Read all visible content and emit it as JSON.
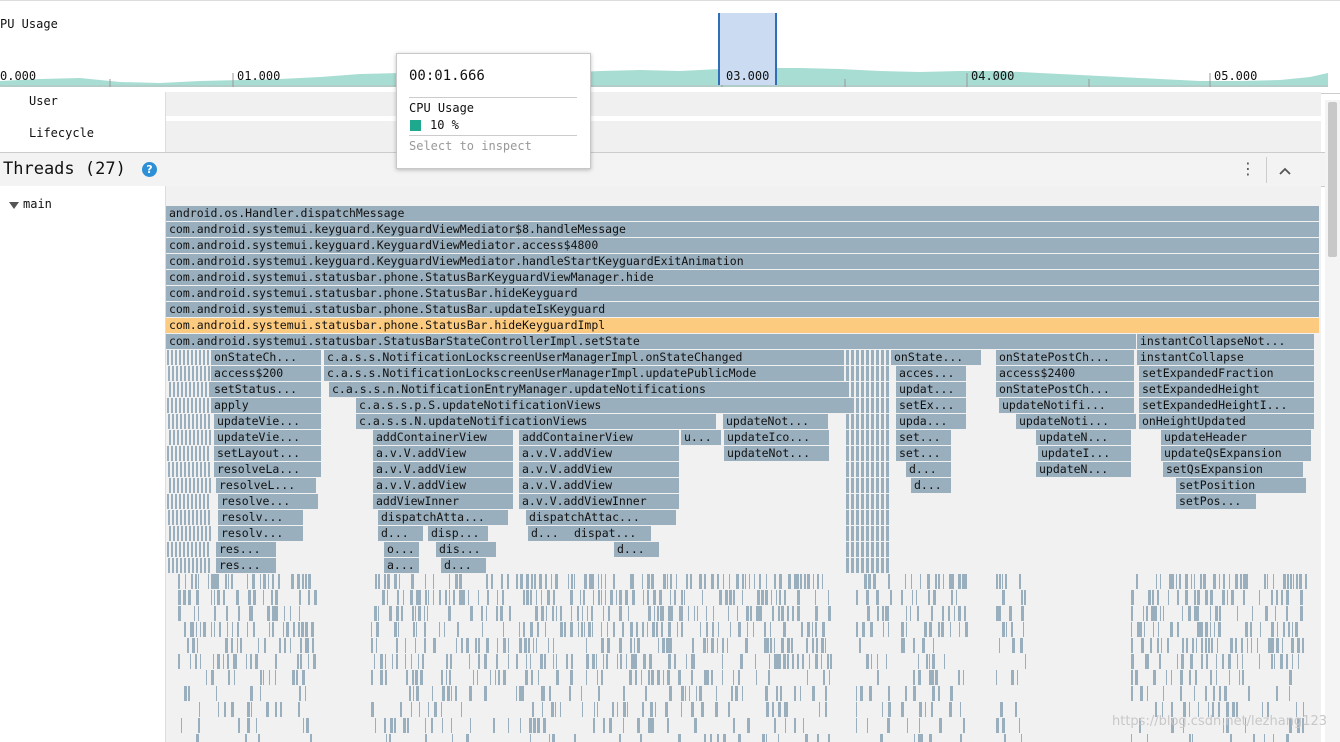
{
  "cpu": {
    "title": "PU Usage",
    "ticks": [
      "0.000",
      "01.000",
      "03.000",
      "04.000",
      "05.000"
    ],
    "colors": {
      "area": "#a8ddd4",
      "selection": "#cbdcf2",
      "selection_border": "#2e6fb8"
    }
  },
  "rows": {
    "user": "User",
    "lifecycle": "Lifecycle"
  },
  "threads": {
    "title": "Threads (27)",
    "help_icon": "help-icon",
    "more_icon": "more-vert-icon",
    "collapse_icon": "chevron-up-icon"
  },
  "thread": {
    "name": "main",
    "expand_icon": "triangle-down-icon"
  },
  "tooltip": {
    "time": "00:01.666",
    "label": "CPU Usage",
    "value": "10 %",
    "hint": "Select to inspect",
    "swatch_color": "#1ea88e"
  },
  "flame": {
    "colors": {
      "frame": "#9aafbe",
      "highlight": "#fccb7f"
    },
    "full_frames": [
      "android.os.Handler.dispatchMessage",
      "com.android.systemui.keyguard.KeyguardViewMediator$8.handleMessage",
      "com.android.systemui.keyguard.KeyguardViewMediator.access$4800",
      "com.android.systemui.keyguard.KeyguardViewMediator.handleStartKeyguardExitAnimation",
      "com.android.systemui.statusbar.phone.StatusBarKeyguardViewManager.hide",
      "com.android.systemui.statusbar.phone.StatusBar.hideKeyguard",
      "com.android.systemui.statusbar.phone.StatusBar.updateIsKeyguard",
      "com.android.systemui.statusbar.phone.StatusBar.hideKeyguardImpl"
    ],
    "labels": [
      "com.android.systemui.statusbar.StatusBarStateControllerImpl.setState",
      "instantCollapseNot...",
      "onStateCh...",
      "c.a.s.s.NotificationLockscreenUserManagerImpl.onStateChanged",
      "onState...",
      "onStatePostCh...",
      "instantCollapse",
      "access$200",
      "c.a.s.s.NotificationLockscreenUserManagerImpl.updatePublicMode",
      "acces...",
      "access$2400",
      "setExpandedFraction",
      "setStatus...",
      "c.a.s.s.n.NotificationEntryManager.updateNotifications",
      "updat...",
      "onStatePostCh...",
      "setExpandedHeight",
      "apply",
      "c.a.s.s.p.S.updateNotificationViews",
      "setEx...",
      "updateNotifi...",
      "setExpandedHeightI...",
      "updateVie...",
      "c.a.s.s.N.updateNotificationViews",
      "updateNot...",
      "upda...",
      "updateNoti...",
      "onHeightUpdated",
      "updateVie...",
      "addContainerView",
      "addContainerView",
      "u...",
      "updateIco...",
      "set...",
      "updateN...",
      "updateHeader",
      "setLayout...",
      "a.v.V.addView",
      "a.v.V.addView",
      "updateNot...",
      "set...",
      "updateI...",
      "updateQsExpansion",
      "resolveLa...",
      "a.v.V.addView",
      "a.v.V.addView",
      "d...",
      "updateN...",
      "setQsExpansion",
      "resolveL...",
      "a.v.V.addView",
      "a.v.V.addView",
      "d...",
      "setPosition",
      "resolve...",
      "addViewInner",
      "a.v.V.addViewInner",
      "setPos...",
      "resolv...",
      "dispatchAtta...",
      "dispatchAttac...",
      "resolv...",
      "d...",
      "disp...",
      "d...",
      "dispat...",
      "res...",
      "o...",
      "dis...",
      "d...",
      "res...",
      "a...",
      "d..."
    ]
  },
  "watermark": "https://blog.csdn.net/lezhang123"
}
